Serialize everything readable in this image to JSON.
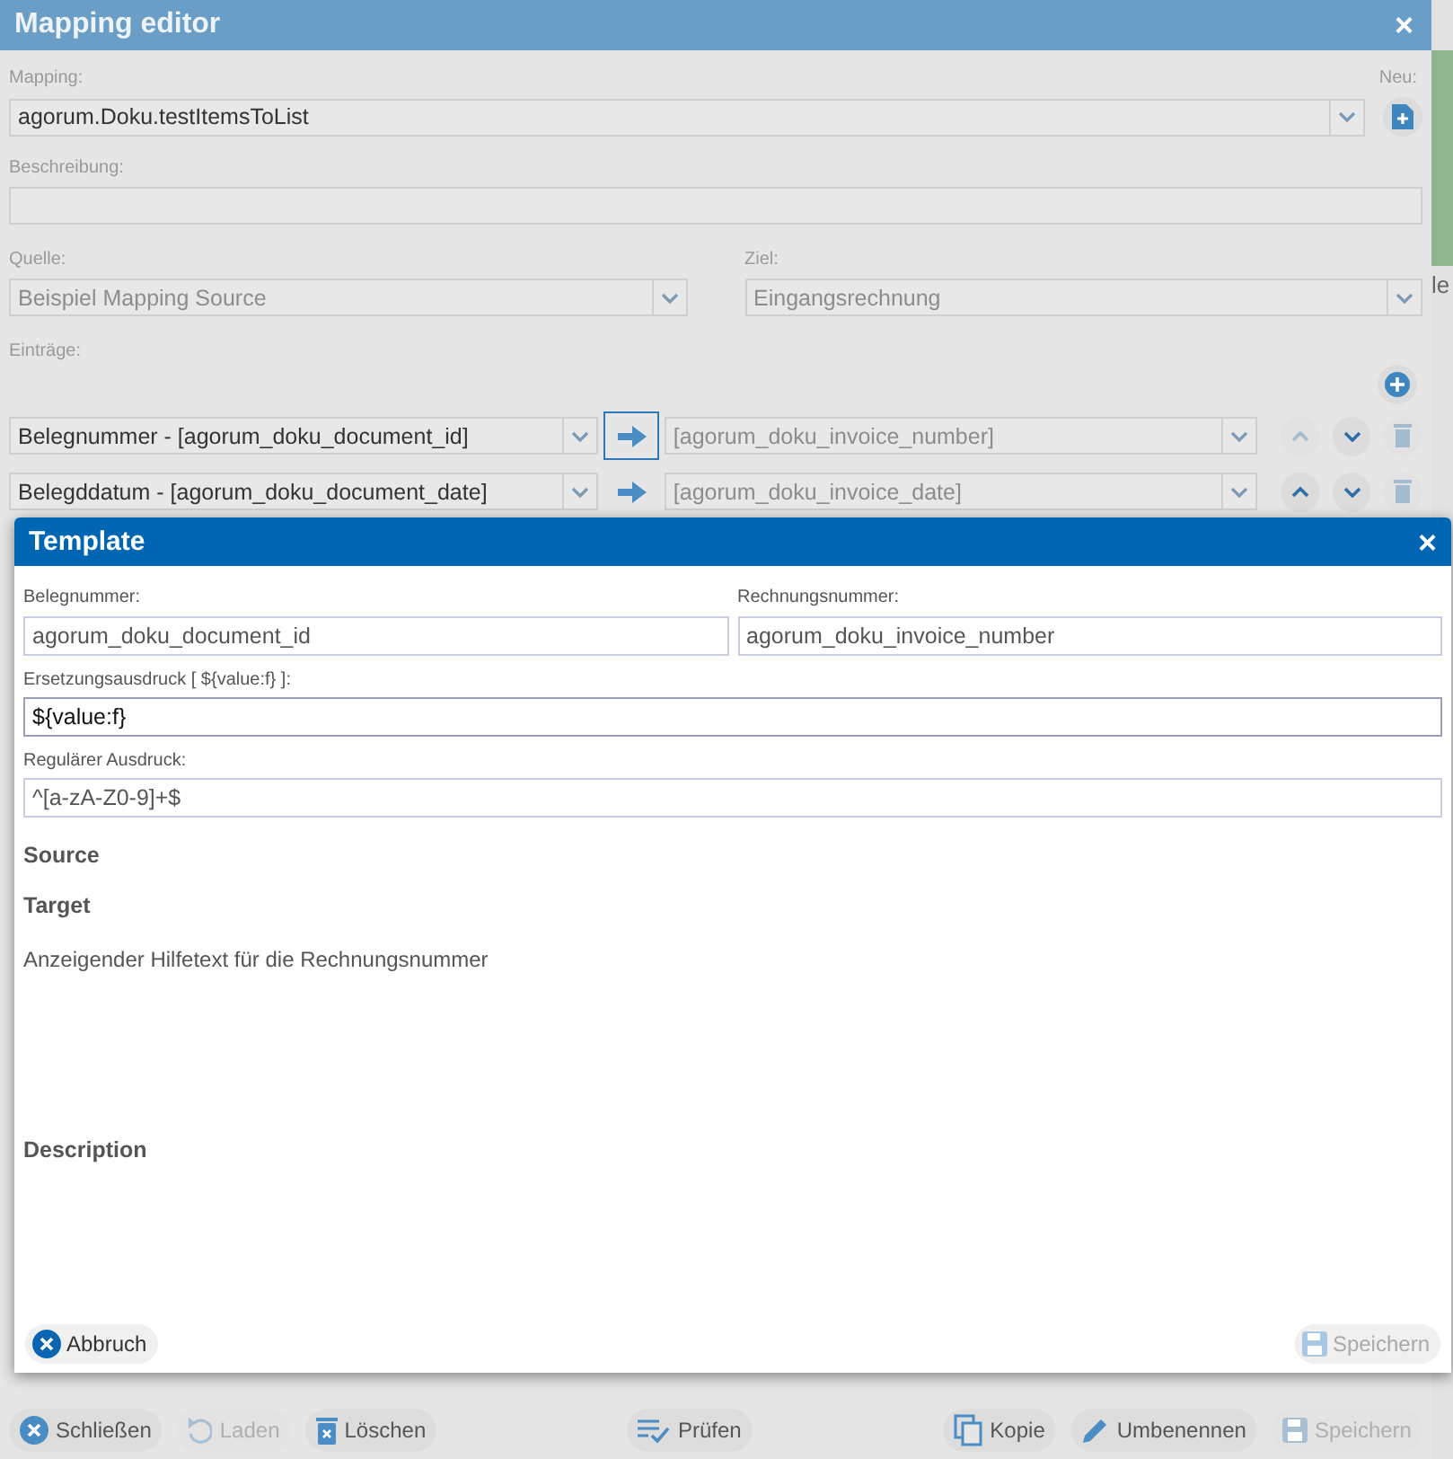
{
  "background": {
    "text": "le"
  },
  "editor": {
    "title": "Mapping editor",
    "close": "×",
    "mapping_label": "Mapping:",
    "mapping_value": "agorum.Doku.testItemsToList",
    "new_label": "Neu:",
    "description_label": "Beschreibung:",
    "source_label": "Quelle:",
    "source_value": "Beispiel Mapping Source",
    "target_label": "Ziel:",
    "target_value": "Eingangsrechnung",
    "entries_label": "Einträge:",
    "entries": [
      {
        "source": "Belegnummer - [agorum_doku_document_id]",
        "target": "[agorum_doku_invoice_number]",
        "selected": true,
        "up_disabled": true,
        "down_disabled": false,
        "delete_disabled": true
      },
      {
        "source": "Belegddatum - [agorum_doku_document_date]",
        "target": "[agorum_doku_invoice_date]",
        "selected": false,
        "up_disabled": false,
        "down_disabled": false,
        "delete_disabled": true
      }
    ],
    "toolbar": [
      {
        "label": "Schließen",
        "disabled": false
      },
      {
        "label": "Laden",
        "disabled": true
      },
      {
        "label": "Löschen",
        "disabled": false
      },
      {
        "label": "Prüfen",
        "disabled": false
      },
      {
        "label": "Kopie",
        "disabled": false
      },
      {
        "label": "Umbenennen",
        "disabled": false
      },
      {
        "label": "Speichern",
        "disabled": true
      }
    ]
  },
  "template": {
    "title": "Template",
    "close": "×",
    "fields_pair": [
      {
        "label": "Belegnummer:",
        "value": "agorum_doku_document_id",
        "focused": false
      },
      {
        "label": "Rechnungsnummer:",
        "value": "agorum_doku_invoice_number",
        "focused": false
      }
    ],
    "fields": [
      {
        "label": "Ersetzungsausdruck [ ${value:f} ]:",
        "value": "${value:f}",
        "focused": true
      },
      {
        "label": "Regulärer Ausdruck:",
        "value": "^[a-zA-Z0-9]+$",
        "focused": false
      }
    ],
    "source_heading": "Source",
    "target_heading": "Target",
    "help_text": "Anzeigender Hilfetext für die Rechnungsnummer",
    "description_heading": "Description",
    "buttons": [
      {
        "label": "Abbruch",
        "disabled": false
      },
      {
        "label": "Speichern",
        "disabled": true
      }
    ]
  }
}
